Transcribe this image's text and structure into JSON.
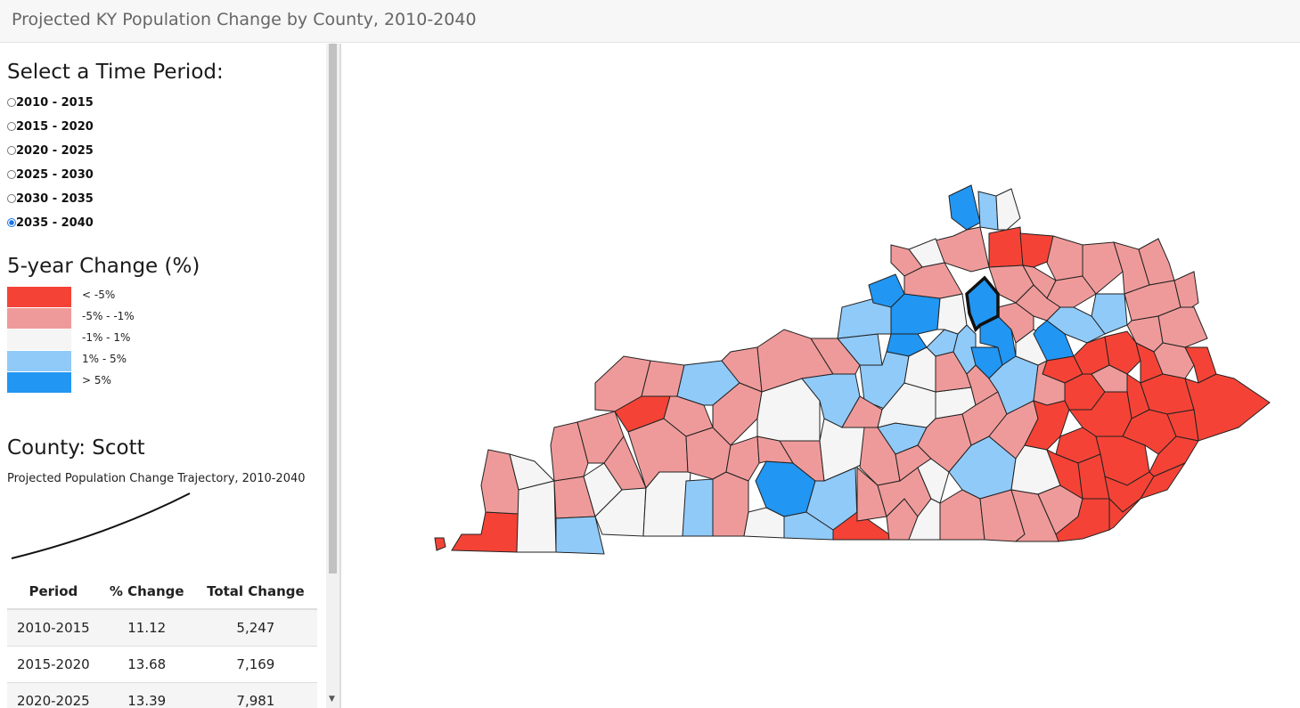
{
  "header": {
    "title": "Projected KY Population Change by County, 2010-2040"
  },
  "time_period": {
    "heading": "Select a Time Period:",
    "options": [
      {
        "label": "2010 - 2015",
        "selected": false
      },
      {
        "label": "2015 - 2020",
        "selected": false
      },
      {
        "label": "2020 - 2025",
        "selected": false
      },
      {
        "label": "2025 - 2030",
        "selected": false
      },
      {
        "label": "2030 - 2035",
        "selected": false
      },
      {
        "label": "2035 - 2040",
        "selected": true
      }
    ]
  },
  "legend": {
    "heading": "5-year Change (%)",
    "items": [
      {
        "label": "< -5%",
        "color": "#f44336"
      },
      {
        "label": "-5% - -1%",
        "color": "#ef9a9a"
      },
      {
        "label": "-1% - 1%",
        "color": "#f5f5f5"
      },
      {
        "label": "1% - 5%",
        "color": "#90caf9"
      },
      {
        "label": "> 5%",
        "color": "#2196f3"
      }
    ]
  },
  "county": {
    "title": "County: Scott",
    "trajectory_title": "Projected Population Change Trajectory, 2010-2040",
    "table": {
      "headers": [
        "Period",
        "% Change",
        "Total Change"
      ],
      "rows": [
        [
          "2010-2015",
          "11.12",
          "5,247"
        ],
        [
          "2015-2020",
          "13.68",
          "7,169"
        ],
        [
          "2020-2025",
          "13.39",
          "7,981"
        ]
      ]
    }
  }
}
